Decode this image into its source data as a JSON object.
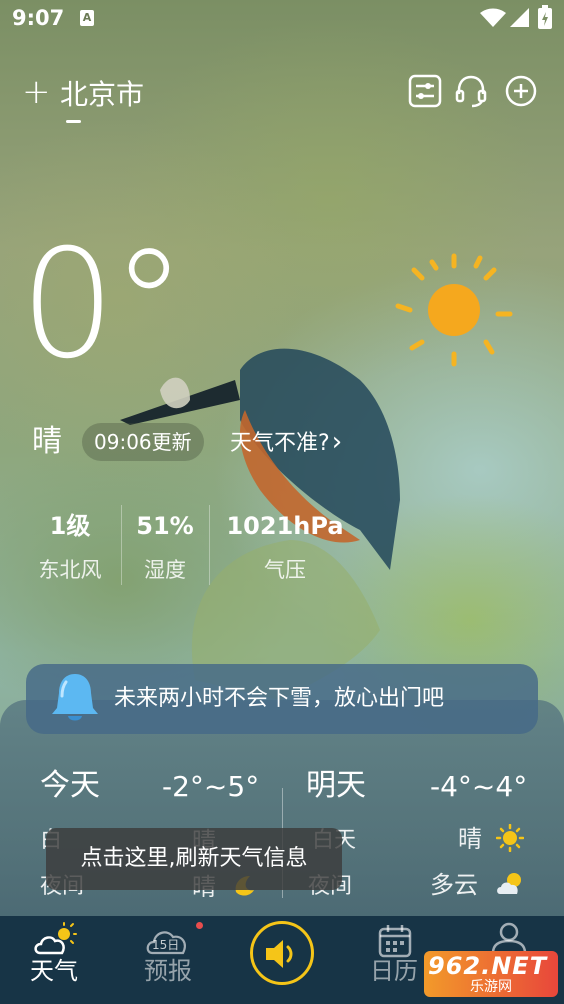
{
  "status_bar": {
    "time": "9:07",
    "notif_letter": "A"
  },
  "header": {
    "add_symbol": "+",
    "city": "北京市"
  },
  "current": {
    "temperature": "0°",
    "condition": "晴",
    "updated": "09:06更新",
    "inaccurate_link": "天气不准?",
    "chevron": "›"
  },
  "stats": [
    {
      "value": "1级",
      "label": "东北风"
    },
    {
      "value": "51%",
      "label": "湿度"
    },
    {
      "value": "1021hPa",
      "label": "气压"
    }
  ],
  "alert": {
    "text": "未来两小时不会下雪，放心出门吧",
    "icon": "bell-icon"
  },
  "forecast": {
    "today": {
      "day": "今天",
      "range": "-2°~5°",
      "day_label": "白",
      "day_cond": "晴",
      "night_label": "夜间",
      "night_cond": "晴"
    },
    "tomorrow": {
      "day": "明天",
      "range": "-4°~4°",
      "day_label": "白天",
      "day_cond": "晴",
      "night_label": "夜间",
      "night_cond": "多云"
    }
  },
  "toast": "点击这里,刷新天气信息",
  "tabs": [
    {
      "label": "天气",
      "icon": "weather-icon",
      "active": true
    },
    {
      "label": "预报",
      "icon": "calendar-15-icon",
      "badge_text": "15日"
    },
    {
      "label": "",
      "icon": "speaker-icon"
    },
    {
      "label": "日历",
      "icon": "calendar-icon"
    },
    {
      "label": "",
      "icon": "user-icon"
    }
  ],
  "watermark": {
    "text": "962.NET",
    "sub": "乐游网"
  },
  "colors": {
    "sun": "#f5b422",
    "tabbar": "#173446",
    "accent": "#f5c518"
  }
}
